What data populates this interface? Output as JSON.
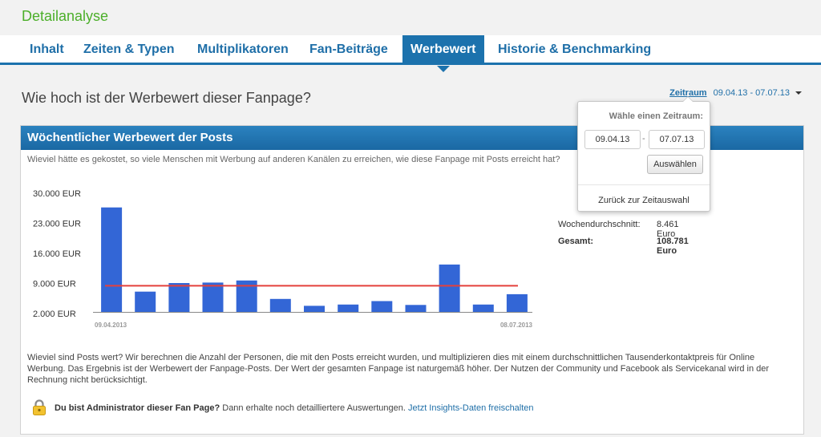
{
  "page": {
    "title": "Detailanalyse",
    "question": "Wie hoch ist der Werbewert dieser Fanpage?"
  },
  "tabs": [
    {
      "label": "Inhalt"
    },
    {
      "label": "Zeiten & Typen"
    },
    {
      "label": "Multiplikatoren"
    },
    {
      "label": "Fan-Beiträge"
    },
    {
      "label": "Werbewert",
      "active": true
    },
    {
      "label": "Historie & Benchmarking"
    }
  ],
  "range": {
    "label": "Zeitraum",
    "value": "09.04.13 - 07.07.13"
  },
  "popover": {
    "title": "Wähle einen Zeitraum:",
    "start_value": "09.04.13",
    "separator": "-",
    "end_value": "07.07.13",
    "select_label": "Auswählen",
    "back_label": "Zurück zur Zeitauswahl"
  },
  "panel": {
    "title": "Wöchentlicher Werbewert der Posts",
    "subtitle": "Wieviel hätte es gekostet, so viele Menschen mit Werbung auf anderen Kanälen zu erreichen, wie diese Fanpage mit Posts erreicht hat?"
  },
  "stats": {
    "avg_label": "Wochendurchschnitt:",
    "avg_value": "8.461 Euro",
    "total_label": "Gesamt:",
    "total_value": "108.781 Euro"
  },
  "explanation": "Wieviel sind Posts wert? Wir berechnen die Anzahl der Personen, die mit den Posts erreicht wurden, und multiplizieren dies mit einem durchschnittlichen Tausenderkontaktpreis für Online Werbung. Das Ergebnis ist der Werbewert der Fanpage-Posts. Der Wert der gesamten Fanpage ist naturgemäß höher. Der Nutzen der Community und Facebook als Servicekanal wird in der Rechnung nicht berücksichtigt.",
  "admin": {
    "bold": "Du bist Administrator dieser Fan Page?",
    "text": " Dann erhalte noch detailliertere Auswertungen. ",
    "link": "Jetzt Insights-Daten freischalten"
  },
  "colors": {
    "bar": "#3366d6",
    "average_line": "#e4413c",
    "accent": "#1c72ad",
    "title_green": "#4caf2a"
  },
  "chart_data": {
    "type": "bar",
    "ytick_labels": [
      "30.000 EUR",
      "23.000 EUR",
      "16.000 EUR",
      "9.000 EUR",
      "2.000 EUR"
    ],
    "yticks": [
      30000,
      23000,
      16000,
      9000,
      2000
    ],
    "ylim": [
      0,
      30000
    ],
    "x_start_label": "09.04.2013",
    "x_end_label": "08.07.2013",
    "values": [
      26700,
      7100,
      9100,
      9200,
      9700,
      5400,
      3800,
      4100,
      4900,
      4000,
      13400,
      4100,
      6500
    ],
    "average": 8461,
    "grid": false,
    "legend": "none"
  }
}
